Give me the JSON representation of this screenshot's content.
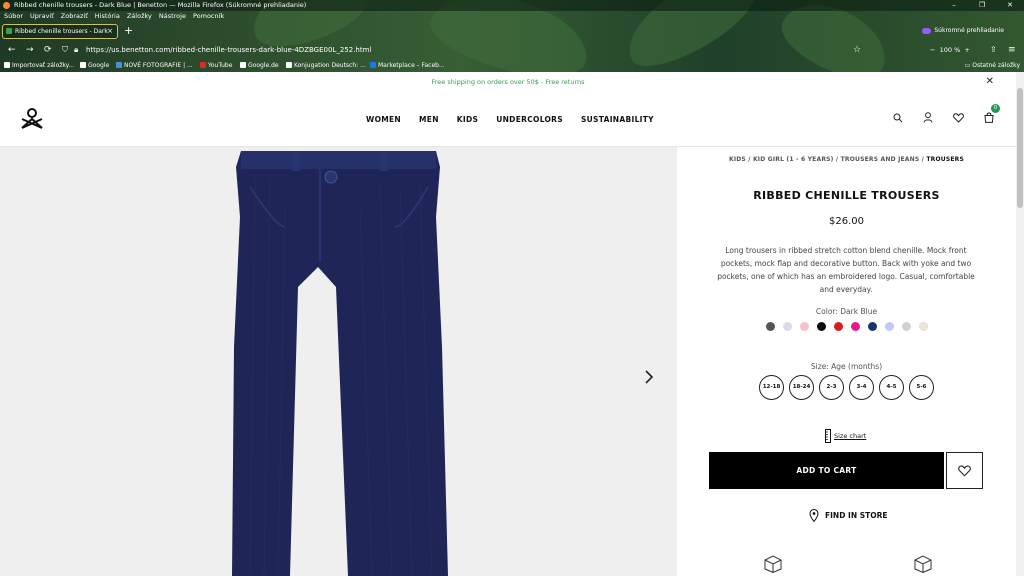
{
  "browser": {
    "window_title": "Ribbed chenille trousers - Dark Blue | Benetton — Mozilla Firefox (Súkromné prehliadanie)",
    "window_buttons": [
      "–",
      "❐",
      "✕"
    ],
    "menu": [
      "Súbor",
      "Upraviť",
      "Zobraziť",
      "História",
      "Záložky",
      "Nástroje",
      "Pomocník"
    ],
    "tab_title": "Ribbed chenille trousers - Dark",
    "new_tab": "+",
    "private_label": "Súkromné prehliadanie",
    "url": "https://us.benetton.com/ribbed-chenille-trousers-dark-blue-4DZBGE00L_252.html",
    "zoom": "100 %",
    "bookmarks": [
      {
        "label": "Importovať záložky...",
        "color": "#ffffff"
      },
      {
        "label": "Google",
        "color": "#ffffff"
      },
      {
        "label": "NOVÉ FOTOGRAFIE | ...",
        "color": "#4a8fd6"
      },
      {
        "label": "YouTube",
        "color": "#e02a2a"
      },
      {
        "label": "Google.de",
        "color": "#ffffff"
      },
      {
        "label": "Konjugation Deutsch: ...",
        "color": "#ffffff"
      },
      {
        "label": "Marketplace – Faceb...",
        "color": "#1877f2"
      }
    ],
    "other_bookmarks": "Ostatné záložky"
  },
  "promo": {
    "text": "Free shipping on orders over 50$ - Free returns",
    "color": "#2f9e4f"
  },
  "nav": {
    "items": [
      "WOMEN",
      "MEN",
      "KIDS",
      "UNDERCOLORS",
      "SUSTAINABILITY"
    ],
    "cart_count": "0"
  },
  "product": {
    "breadcrumbs": [
      "KIDS",
      "KID GIRL (1 - 6 YEARS)",
      "TROUSERS AND JEANS"
    ],
    "breadcrumb_current": "TROUSERS",
    "title": "RIBBED CHENILLE TROUSERS",
    "price": "$26.00",
    "description": "Long trousers in ribbed stretch cotton blend chenille. Mock front pockets, mock flap and decorative button. Back with yoke and two pockets, one of which has an embroidered logo. Casual, comfortable and everyday.",
    "color_label": "Color: Dark Blue",
    "colors": [
      "#555555",
      "#dcd6f2",
      "#f5c0cc",
      "#0a0a0a",
      "#d81c1c",
      "#e8198b",
      "#1b3470",
      "#c3c8f5",
      "#cfcfcf",
      "#eee6d2"
    ],
    "size_label": "Size: Age (months)",
    "sizes": [
      "12-18",
      "18-24",
      "2-3",
      "3-4",
      "4-5",
      "5-6"
    ],
    "size_chart": "Size chart",
    "add_to_cart": "ADD TO CART",
    "find_in_store": "FIND IN STORE",
    "trouser_color": "#1f2557"
  }
}
